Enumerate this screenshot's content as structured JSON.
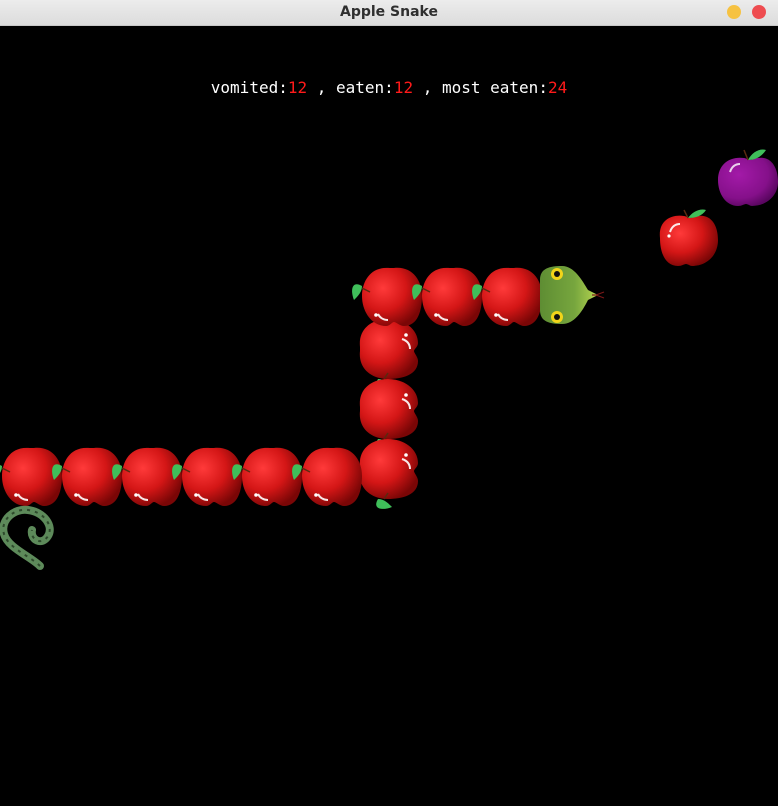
{
  "window": {
    "title": "Apple Snake",
    "accent_minimize": "#f6c242",
    "accent_close": "#ee4c50"
  },
  "score": {
    "vomited_label": "vomited:",
    "vomited_value": "12",
    "eaten_label": ", eaten:",
    "eaten_value": "12",
    "most_eaten_label": ", most eaten:",
    "most_eaten_value": "24"
  },
  "colors": {
    "background": "#000000",
    "apple_red": "#d81818",
    "leaf_green": "#3fbf5a",
    "snake_head": "#6b9c3a",
    "plum": "#8a0f8e",
    "worm": "#5d8a5a"
  },
  "sprites": {
    "snake_body": "red-apple-icon",
    "snake_head": "snake-head-icon",
    "food_apple": "red-apple-icon",
    "food_plum": "purple-plum-icon",
    "worm": "worm-icon"
  }
}
